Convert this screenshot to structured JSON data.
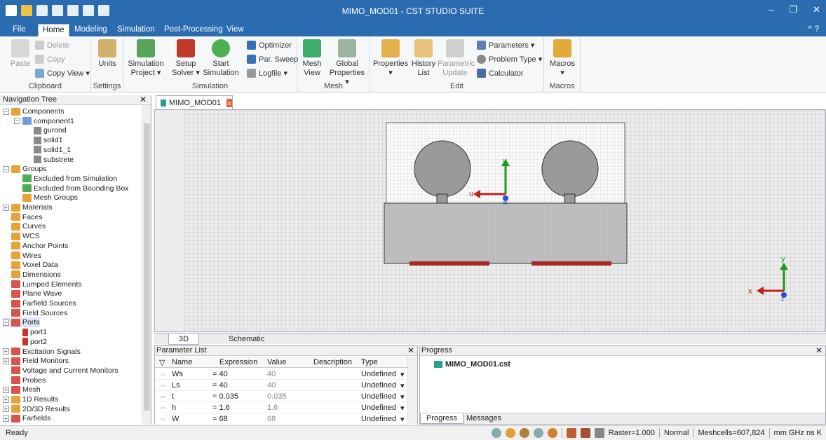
{
  "window": {
    "title": "MIMO_MOD01 - CST STUDIO SUITE",
    "minimize": "‒",
    "restore": "❐",
    "close": "✕"
  },
  "menu_tabs": [
    "File",
    "Home",
    "Modeling",
    "Simulation",
    "Post-Processing",
    "View"
  ],
  "help": "^ ?",
  "ribbon": {
    "clipboard": {
      "paste": "Paste",
      "delete": "Delete",
      "copy": "Copy",
      "copy_view": "Copy View ▾",
      "label": "Clipboard"
    },
    "settings": {
      "units": "Units",
      "label": "Settings"
    },
    "simulation": {
      "project_1": "Simulation",
      "project_2": "Project ▾",
      "setup_1": "Setup",
      "setup_2": "Solver ▾",
      "start_1": "Start",
      "start_2": "Simulation",
      "optimizer": "Optimizer",
      "par_sweep": "Par. Sweep",
      "logfile": "Logfile ▾",
      "label": "Simulation"
    },
    "mesh": {
      "view_1": "Mesh",
      "view_2": "View",
      "global_1": "Global",
      "global_2": "Properties ▾",
      "label": "Mesh"
    },
    "edit": {
      "properties": "Properties",
      "properties_arrow": "▾",
      "history_1": "History",
      "history_2": "List",
      "param_1": "Parametric",
      "param_2": "Update",
      "parameters": "Parameters ▾",
      "problem_type": "Problem Type ▾",
      "calculator": "Calculator",
      "label": "Edit"
    },
    "macros": {
      "macros": "Macros",
      "arrow": "▾",
      "label": "Macros"
    }
  },
  "nav": {
    "title": "Navigation Tree",
    "close": "✕",
    "items": [
      "Components",
      "component1",
      "gurond",
      "solid1",
      "solid1_1",
      "substrete",
      "Groups",
      "Excluded from Simulation",
      "Excluded from Bounding Box",
      "Mesh Groups",
      "Materials",
      "Faces",
      "Curves",
      "WCS",
      "Anchor Points",
      "Wires",
      "Voxel Data",
      "Dimensions",
      "Lumped Elements",
      "Plane Wave",
      "Farfield Sources",
      "Field Sources",
      "Ports",
      "port1",
      "port2",
      "Excitation Signals",
      "Field Monitors",
      "Voltage and Current Monitors",
      "Probes",
      "Mesh",
      "1D Results",
      "2D/3D Results",
      "Farfields"
    ]
  },
  "doc_tab": {
    "label": "MIMO_MOD01",
    "close": "x"
  },
  "view_tabs": [
    "3D",
    "Schematic"
  ],
  "axes": {
    "u": "u",
    "v": "v",
    "w": "w",
    "x": "x",
    "y": "y",
    "z": "z"
  },
  "params": {
    "title": "Parameter List",
    "close": "✕",
    "headers": [
      "Name",
      "Expression",
      "Value",
      "Description",
      "Type"
    ],
    "rows": [
      {
        "name": "Ws",
        "expr": "= 40",
        "value": "40",
        "type": "Undefined"
      },
      {
        "name": "Ls",
        "expr": "= 40",
        "value": "40",
        "type": "Undefined"
      },
      {
        "name": "t",
        "expr": "= 0.035",
        "value": "0.035",
        "type": "Undefined"
      },
      {
        "name": "h",
        "expr": "= 1.6",
        "value": "1.6",
        "type": "Undefined"
      },
      {
        "name": "W",
        "expr": "= 68",
        "value": "68",
        "type": "Undefined"
      }
    ]
  },
  "progress": {
    "title": "Progress",
    "close": "✕",
    "file": "MIMO_MOD01.cst",
    "tabs": [
      "Progress",
      "Messages"
    ]
  },
  "status": {
    "ready": "Ready",
    "raster": "Raster=1.000",
    "mode": "Normal",
    "meshcells": "Meshcells=607,824",
    "units": "mm  GHz  ns  K"
  },
  "colors": {
    "title_bar": "#2b6cb0",
    "ground_plane": "#bfbfbf",
    "patch": "#a8a8a8",
    "port": "#a52a2a"
  }
}
